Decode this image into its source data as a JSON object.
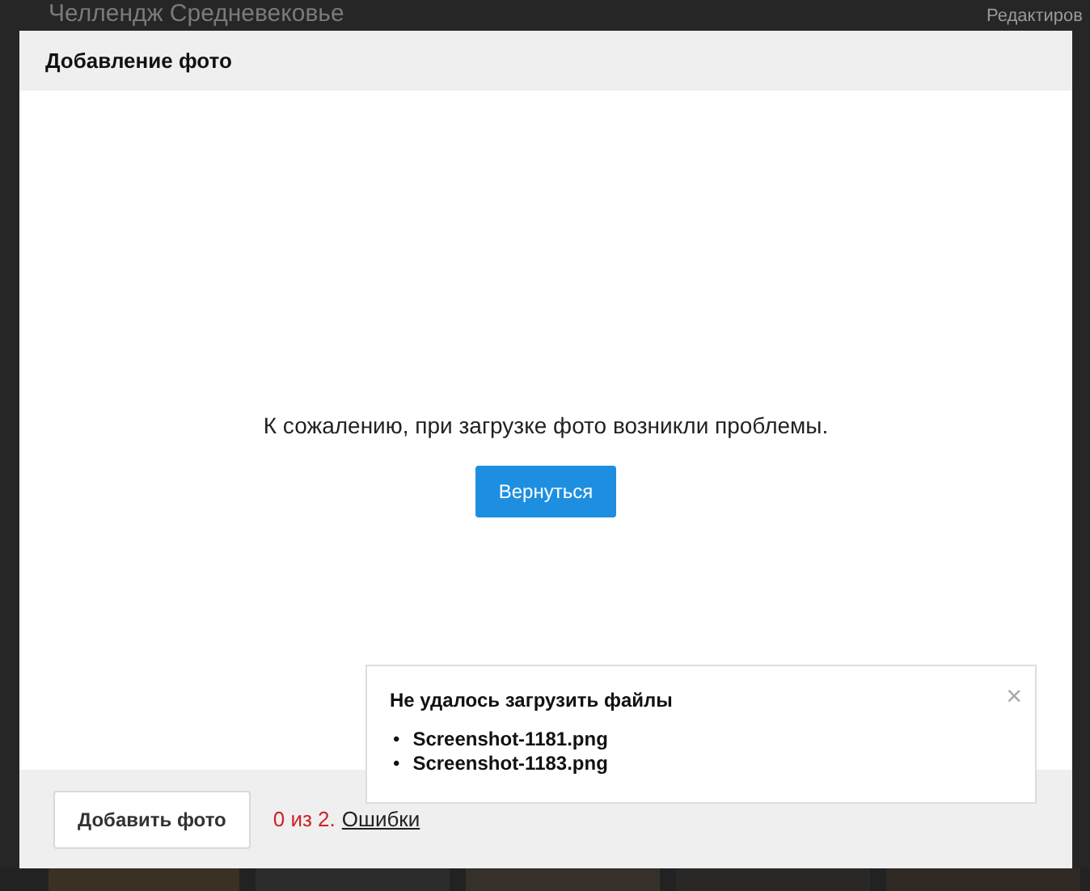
{
  "background_page": {
    "title": "Челлендж Средневековье",
    "edit_link": "Редактиров"
  },
  "modal": {
    "title": "Добавление фото",
    "message": "К сожалению, при загрузке фото возникли проблемы.",
    "back_button": "Вернуться",
    "footer": {
      "add_button": "Добавить фото",
      "progress": "0 из 2.",
      "progress_error": true,
      "errors_link": "Ошибки"
    }
  },
  "toast": {
    "title": "Не удалось загрузить файлы",
    "close": "×",
    "bullet": "•",
    "files": [
      "Screenshot-1181.png",
      "Screenshot-1183.png"
    ]
  }
}
